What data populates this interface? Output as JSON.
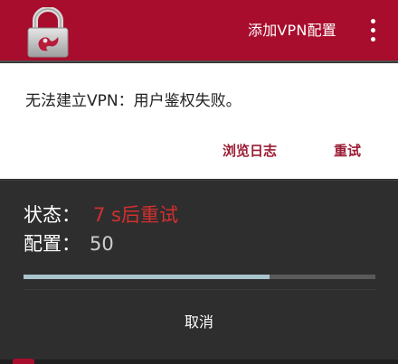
{
  "appbar": {
    "add_vpn_label": "添加VPN配置",
    "overflow_icon": "more-vert-icon",
    "logo_icon": "padlock-logo",
    "background_color": "#a80d2d"
  },
  "content": {
    "message": "无法建立VPN：用户鉴权失败。",
    "view_logs_label": "浏览日志",
    "retry_label": "重试",
    "button_color": "#9a1b33"
  },
  "dialog": {
    "status_label": "状态：",
    "status_value": "7 s后重试",
    "status_color": "#d32f2f",
    "config_label": "配置：",
    "config_value": "50",
    "progress": 0.7,
    "cancel_label": "取消"
  }
}
